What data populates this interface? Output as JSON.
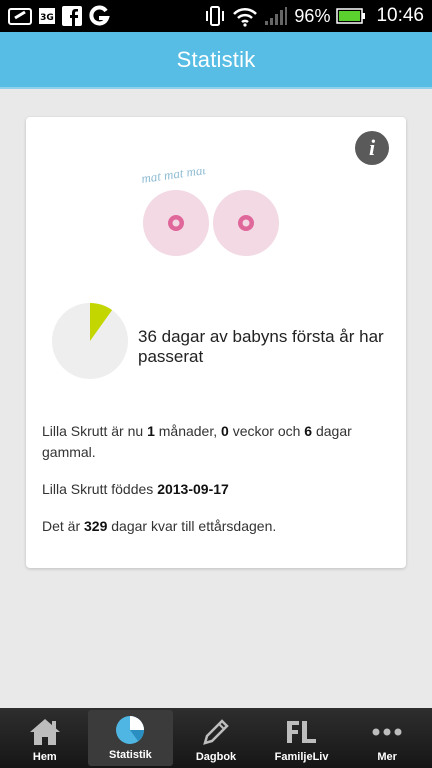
{
  "status_bar": {
    "battery_percent": "96%",
    "time": "10:46",
    "icons": [
      "download-tray-icon",
      "3g-data-icon",
      "facebook-icon",
      "google-icon",
      "vibrate-icon",
      "wifi-icon",
      "signal-icon",
      "battery-icon"
    ]
  },
  "header": {
    "title": "Statistik"
  },
  "card": {
    "illustration_text": "mat mat mat",
    "pie": {
      "days_passed": 36,
      "days_total": 365,
      "fill_color": "#c4d600",
      "base_color": "#eeeeee"
    },
    "pie_label": "36 dagar av babyns första år har passerat",
    "age": {
      "prefix": "Lilla Skrutt är nu",
      "months": "1",
      "months_label": "månader,",
      "weeks": "0",
      "weeks_label": "veckor och",
      "days": "6",
      "days_label": "dagar gammal."
    },
    "birth": {
      "prefix": "Lilla Skrutt föddes",
      "date": "2013-09-17"
    },
    "remaining": {
      "prefix": "Det är",
      "days": "329",
      "suffix": "dagar kvar till ettårsdagen."
    }
  },
  "tabs": [
    {
      "label": "Hem",
      "icon": "home-icon",
      "active": false
    },
    {
      "label": "Statistik",
      "icon": "pie-chart-icon",
      "active": true
    },
    {
      "label": "Dagbok",
      "icon": "pencil-icon",
      "active": false
    },
    {
      "label": "FamiljeLiv",
      "icon": "familjeliv-logo-icon",
      "active": false
    },
    {
      "label": "Mer",
      "icon": "more-dots-icon",
      "active": false
    }
  ],
  "colors": {
    "header": "#57bde4",
    "accent": "#c4d600",
    "breast": "#f2d9e4",
    "nipple": "#e0679a"
  }
}
